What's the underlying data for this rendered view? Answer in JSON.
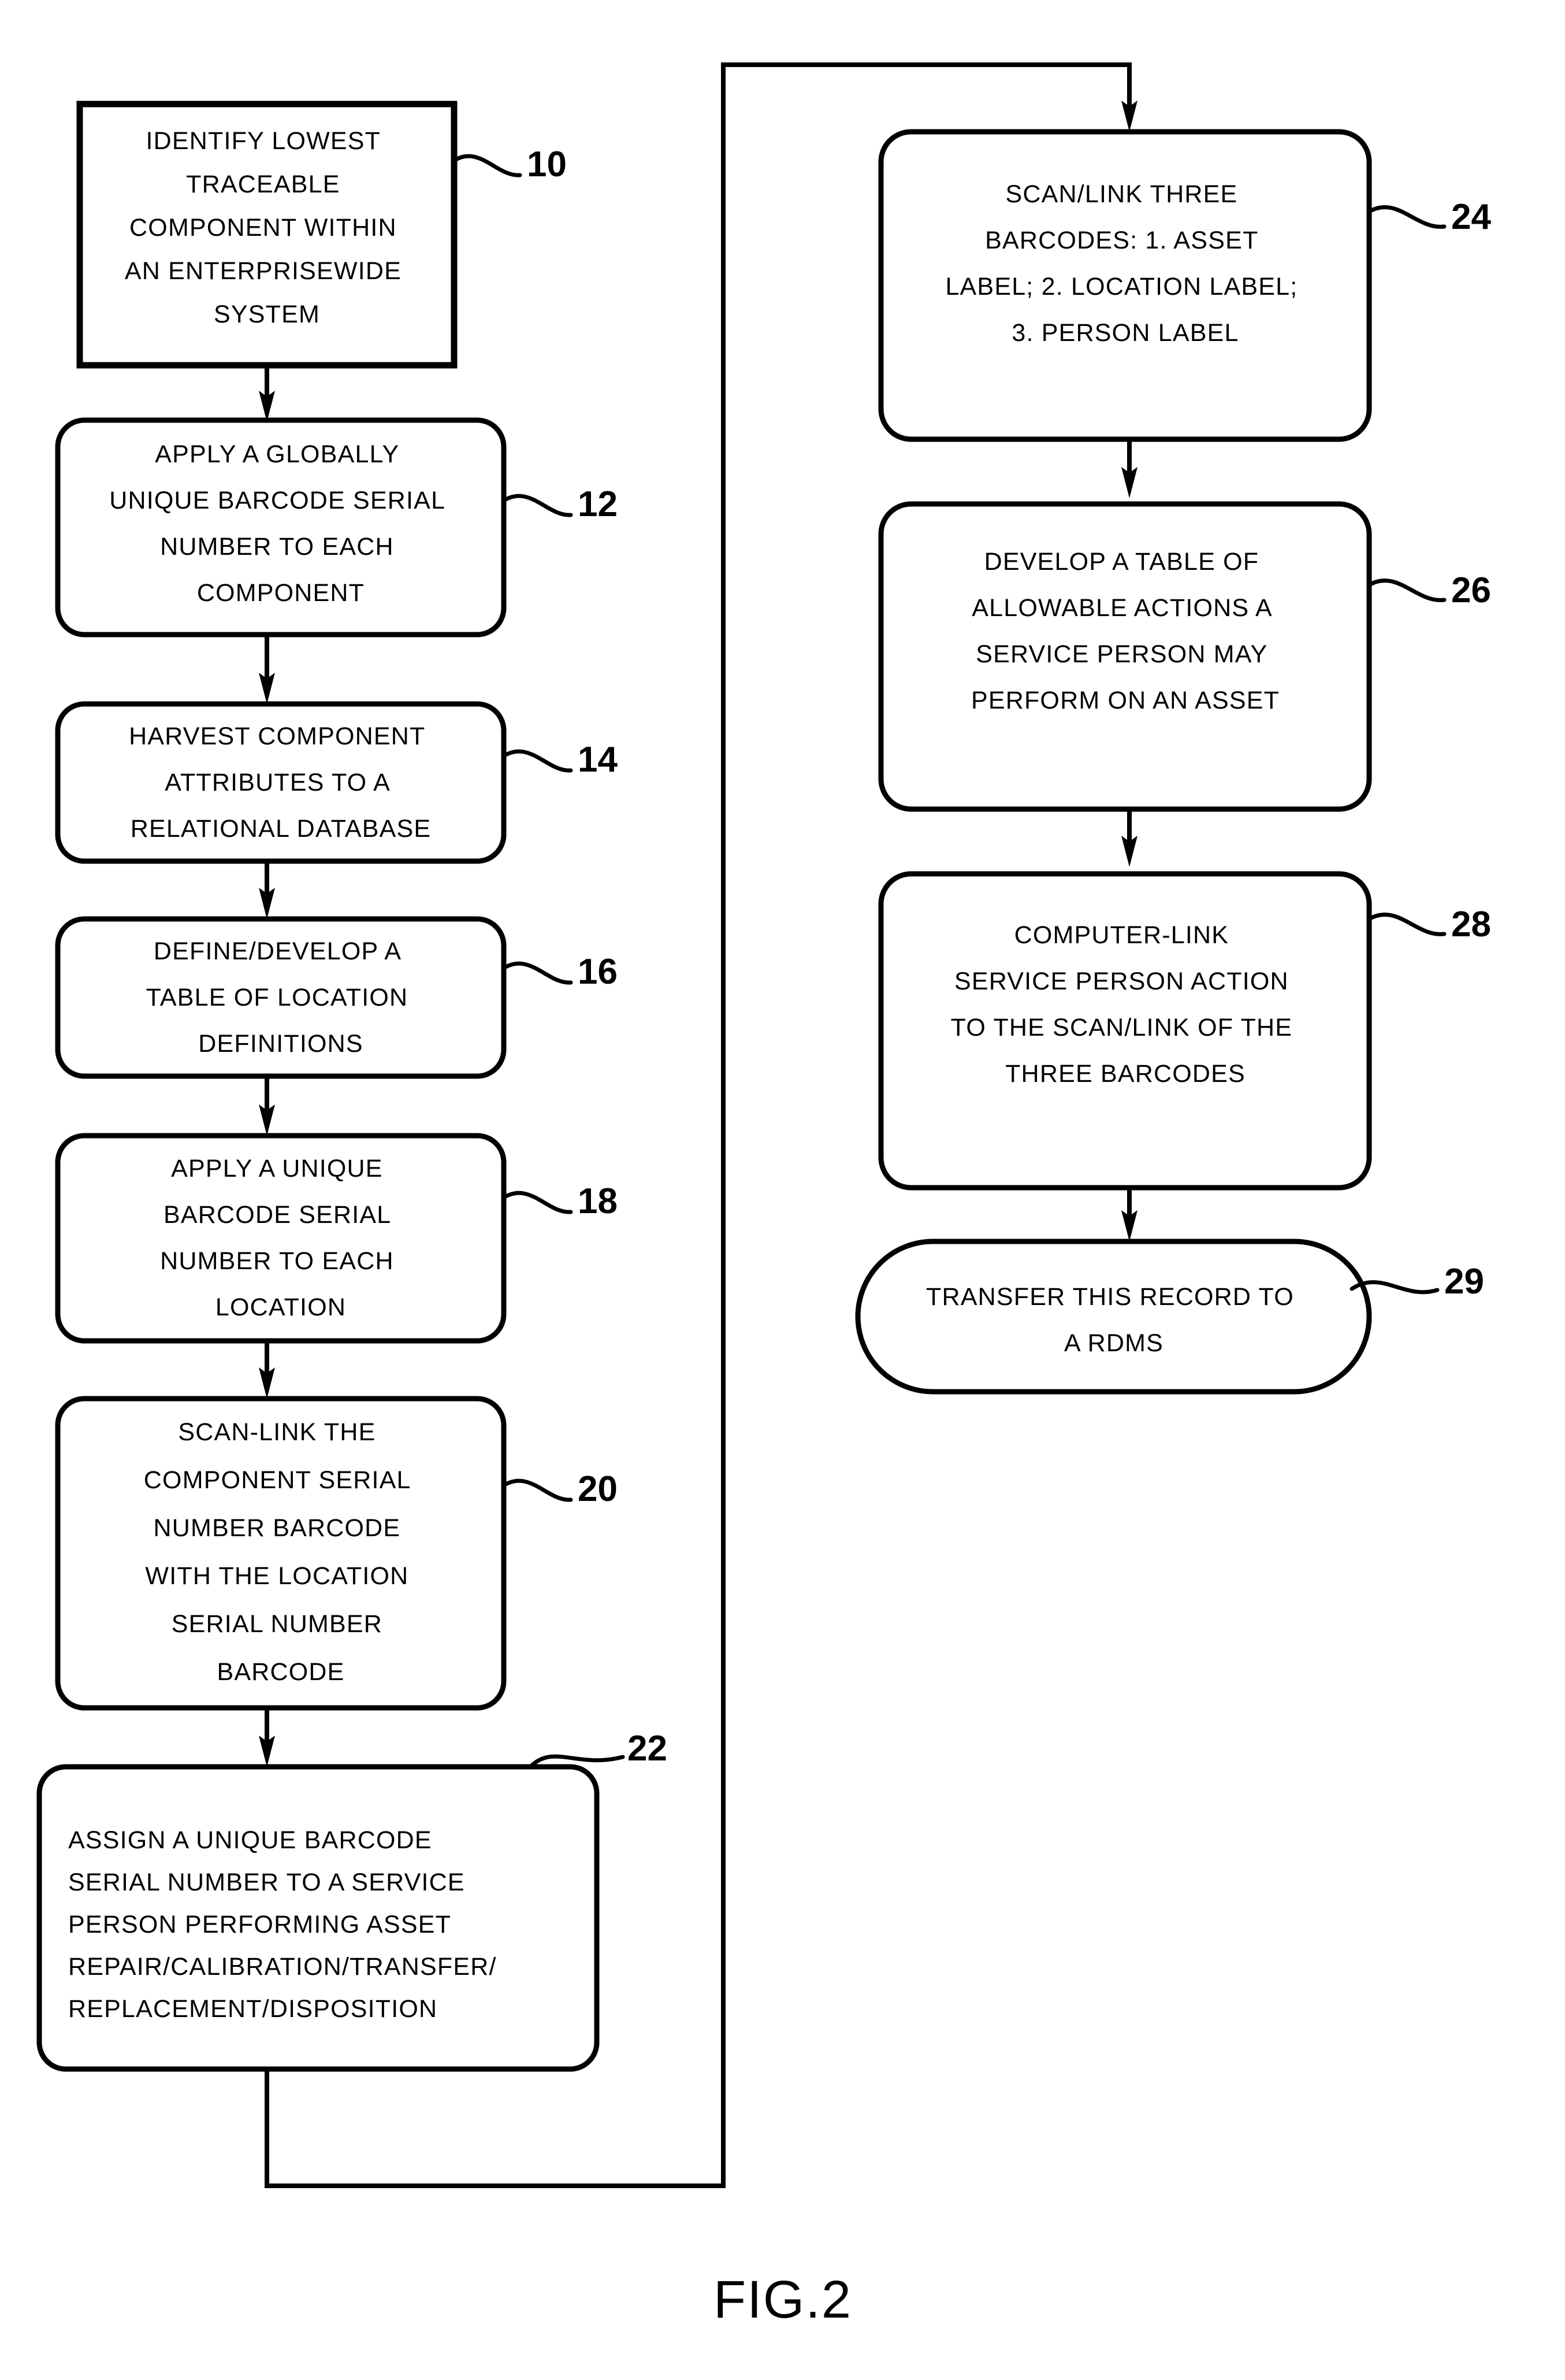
{
  "figure": {
    "caption": "FIG.2",
    "title": "Asset tracking barcode process flowchart"
  },
  "nodes": [
    {
      "id": "node-10",
      "ref": "10",
      "shape": "rectangle",
      "align": "center",
      "lines": [
        "IDENTIFY LOWEST",
        "TRACEABLE",
        "COMPONENT WITHIN",
        "AN ENTERPRISEWIDE",
        "SYSTEM"
      ]
    },
    {
      "id": "node-12",
      "ref": "12",
      "shape": "rounded-rectangle",
      "align": "center",
      "lines": [
        "APPLY A GLOBALLY",
        "UNIQUE BARCODE SERIAL",
        "NUMBER TO EACH",
        "COMPONENT"
      ]
    },
    {
      "id": "node-14",
      "ref": "14",
      "shape": "rounded-rectangle",
      "align": "center",
      "lines": [
        "HARVEST COMPONENT",
        "ATTRIBUTES TO A",
        "RELATIONAL DATABASE"
      ]
    },
    {
      "id": "node-16",
      "ref": "16",
      "shape": "rounded-rectangle",
      "align": "center",
      "lines": [
        "DEFINE/DEVELOP A",
        "TABLE OF LOCATION",
        "DEFINITIONS"
      ]
    },
    {
      "id": "node-18",
      "ref": "18",
      "shape": "rounded-rectangle",
      "align": "center",
      "lines": [
        "APPLY A UNIQUE",
        "BARCODE SERIAL",
        "NUMBER TO EACH",
        "LOCATION"
      ]
    },
    {
      "id": "node-20",
      "ref": "20",
      "shape": "rounded-rectangle",
      "align": "center",
      "lines": [
        "SCAN-LINK THE",
        "COMPONENT SERIAL",
        "NUMBER BARCODE",
        "WITH THE LOCATION",
        "SERIAL NUMBER",
        "BARCODE"
      ]
    },
    {
      "id": "node-22",
      "ref": "22",
      "shape": "rounded-rectangle",
      "align": "left",
      "lines": [
        "ASSIGN A UNIQUE BARCODE",
        "SERIAL NUMBER TO A SERVICE",
        "PERSON PERFORMING ASSET",
        "REPAIR/CALIBRATION/TRANSFER/",
        "REPLACEMENT/DISPOSITION"
      ]
    },
    {
      "id": "node-24",
      "ref": "24",
      "shape": "rounded-rectangle",
      "align": "center",
      "lines": [
        "SCAN/LINK THREE",
        "BARCODES: 1. ASSET",
        "LABEL; 2. LOCATION LABEL;",
        "3. PERSON LABEL"
      ]
    },
    {
      "id": "node-26",
      "ref": "26",
      "shape": "rounded-rectangle",
      "align": "center",
      "lines": [
        "DEVELOP A TABLE OF",
        "ALLOWABLE ACTIONS A",
        "SERVICE PERSON MAY",
        "PERFORM ON AN ASSET"
      ]
    },
    {
      "id": "node-28",
      "ref": "28",
      "shape": "rounded-rectangle",
      "align": "center",
      "lines": [
        "COMPUTER-LINK",
        "SERVICE PERSON ACTION",
        "TO THE SCAN/LINK OF THE",
        "THREE BARCODES"
      ]
    },
    {
      "id": "node-29",
      "ref": "29",
      "shape": "stadium",
      "align": "center",
      "lines": [
        "TRANSFER THIS RECORD TO",
        "A RDMS"
      ]
    }
  ],
  "edges": [
    {
      "id": "edge-10-12",
      "from": "10",
      "to": "12",
      "kind": "arrow-down"
    },
    {
      "id": "edge-12-14",
      "from": "12",
      "to": "14",
      "kind": "arrow-down"
    },
    {
      "id": "edge-14-16",
      "from": "14",
      "to": "16",
      "kind": "arrow-down"
    },
    {
      "id": "edge-16-18",
      "from": "16",
      "to": "18",
      "kind": "arrow-down"
    },
    {
      "id": "edge-18-20",
      "from": "18",
      "to": "20",
      "kind": "arrow-down"
    },
    {
      "id": "edge-20-22",
      "from": "20",
      "to": "22",
      "kind": "arrow-down"
    },
    {
      "id": "edge-22-24",
      "from": "22",
      "to": "24",
      "kind": "wrap-around"
    },
    {
      "id": "edge-24-26",
      "from": "24",
      "to": "26",
      "kind": "arrow-down"
    },
    {
      "id": "edge-26-28",
      "from": "26",
      "to": "28",
      "kind": "arrow-down"
    },
    {
      "id": "edge-28-29",
      "from": "28",
      "to": "29",
      "kind": "arrow-down"
    }
  ],
  "colors": {
    "ink": "#000000",
    "paper": "#ffffff"
  }
}
